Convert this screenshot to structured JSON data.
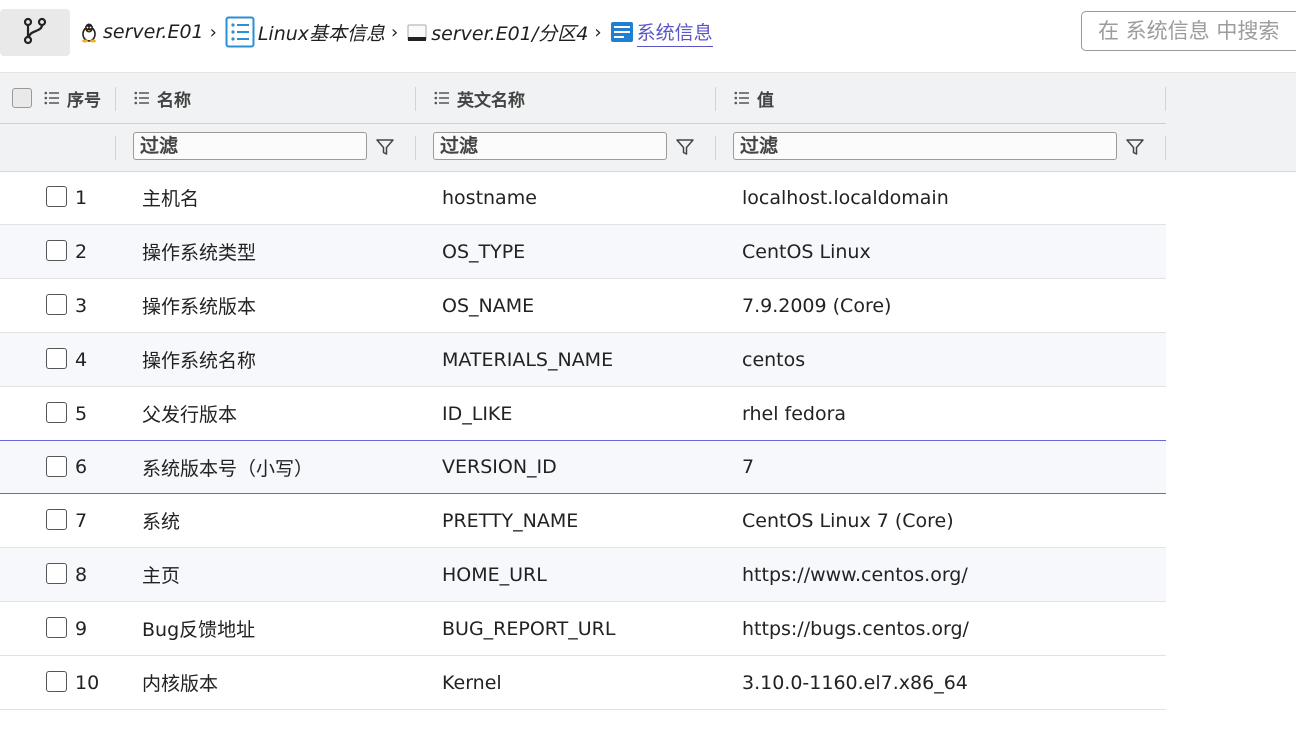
{
  "breadcrumb": [
    {
      "icon": "linux-penguin-icon",
      "label": "server.E01"
    },
    {
      "icon": "list-icon",
      "label": "Linux基本信息"
    },
    {
      "icon": "disk-icon",
      "label": "server.E01/分区4"
    },
    {
      "icon": "info-card-icon",
      "label": "系统信息"
    }
  ],
  "search": {
    "placeholder": "在 系统信息 中搜索"
  },
  "columns": {
    "index": "序号",
    "name": "名称",
    "english_name": "英文名称",
    "value": "值"
  },
  "filter": {
    "placeholder": "过滤"
  },
  "rows": [
    {
      "index": "1",
      "name": "主机名",
      "english_name": "hostname",
      "value": "localhost.localdomain"
    },
    {
      "index": "2",
      "name": "操作系统类型",
      "english_name": "OS_TYPE",
      "value": "CentOS Linux"
    },
    {
      "index": "3",
      "name": "操作系统版本",
      "english_name": "OS_NAME",
      "value": "7.9.2009 (Core)"
    },
    {
      "index": "4",
      "name": "操作系统名称",
      "english_name": "MATERIALS_NAME",
      "value": "centos"
    },
    {
      "index": "5",
      "name": "父发行版本",
      "english_name": "ID_LIKE",
      "value": "rhel fedora"
    },
    {
      "index": "6",
      "name": "系统版本号（小写）",
      "english_name": "VERSION_ID",
      "value": "7"
    },
    {
      "index": "7",
      "name": "系统",
      "english_name": "PRETTY_NAME",
      "value": "CentOS Linux 7 (Core)"
    },
    {
      "index": "8",
      "name": "主页",
      "english_name": "HOME_URL",
      "value": "https://www.centos.org/"
    },
    {
      "index": "9",
      "name": "Bug反馈地址",
      "english_name": "BUG_REPORT_URL",
      "value": "https://bugs.centos.org/"
    },
    {
      "index": "10",
      "name": "内核版本",
      "english_name": "Kernel",
      "value": "3.10.0-1160.el7.x86_64"
    }
  ],
  "colors": {
    "accent": "#5b54c6",
    "selected_border": "#6b66d9"
  }
}
